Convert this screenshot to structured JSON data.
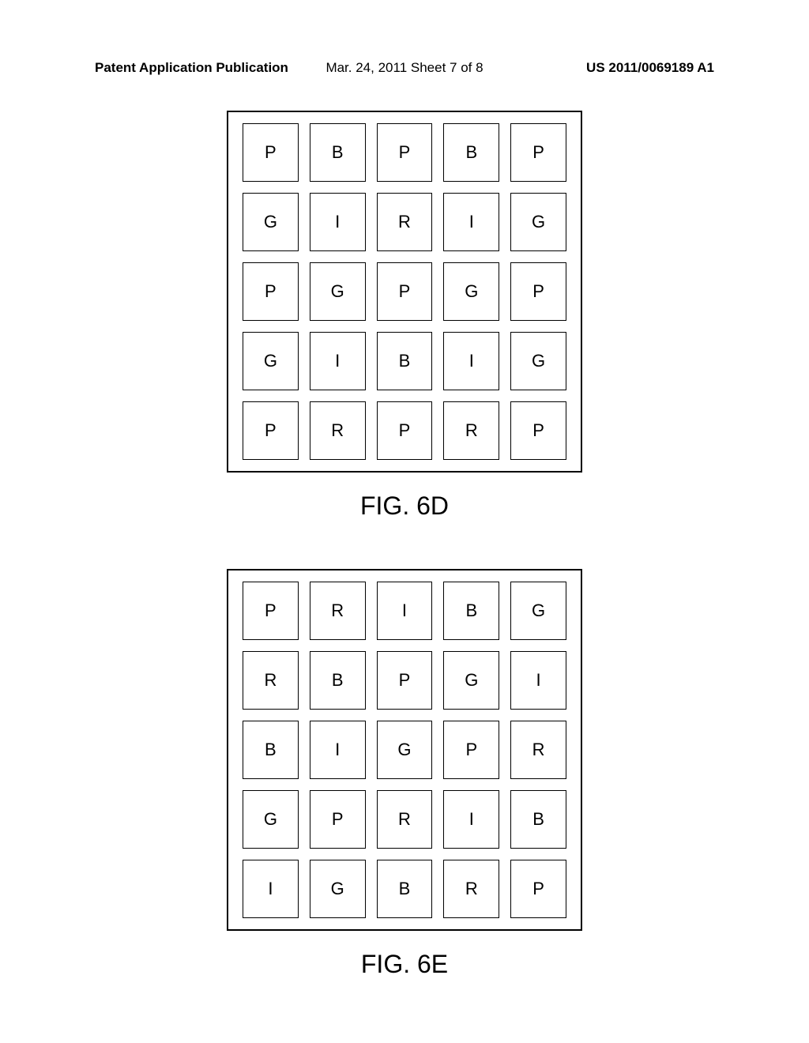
{
  "header": {
    "left": "Patent Application Publication",
    "center": "Mar. 24, 2011  Sheet 7 of 8",
    "right": "US 2011/0069189 A1"
  },
  "figure_6d": {
    "label": "FIG. 6D",
    "grid": [
      [
        "P",
        "B",
        "P",
        "B",
        "P"
      ],
      [
        "G",
        "I",
        "R",
        "I",
        "G"
      ],
      [
        "P",
        "G",
        "P",
        "G",
        "P"
      ],
      [
        "G",
        "I",
        "B",
        "I",
        "G"
      ],
      [
        "P",
        "R",
        "P",
        "R",
        "P"
      ]
    ]
  },
  "figure_6e": {
    "label": "FIG. 6E",
    "grid": [
      [
        "P",
        "R",
        "I",
        "B",
        "G"
      ],
      [
        "R",
        "B",
        "P",
        "G",
        "I"
      ],
      [
        "B",
        "I",
        "G",
        "P",
        "R"
      ],
      [
        "G",
        "P",
        "R",
        "I",
        "B"
      ],
      [
        "I",
        "G",
        "B",
        "R",
        "P"
      ]
    ]
  }
}
